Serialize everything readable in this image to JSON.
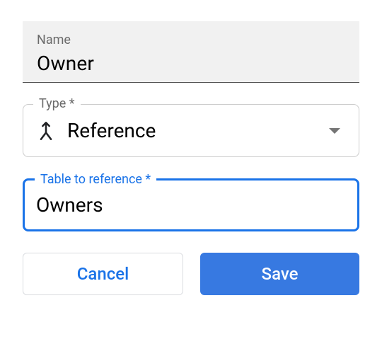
{
  "fields": {
    "name": {
      "label": "Name",
      "value": "Owner"
    },
    "type": {
      "label": "Type *",
      "value": "Reference",
      "icon": "merge-arrow-icon"
    },
    "tableRef": {
      "label": "Table to reference *",
      "value": "Owners"
    }
  },
  "buttons": {
    "cancel": "Cancel",
    "save": "Save"
  }
}
